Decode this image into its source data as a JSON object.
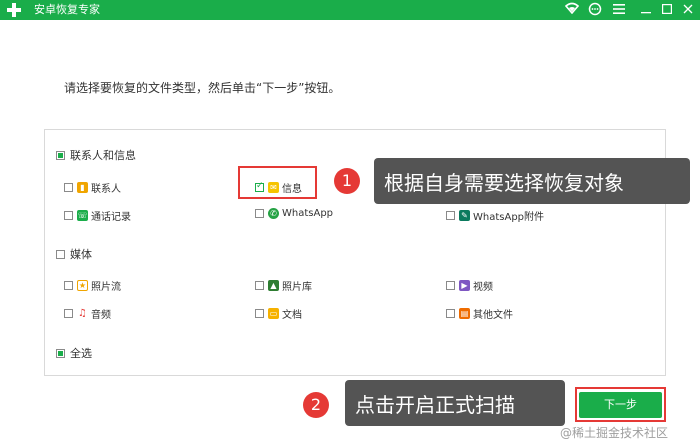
{
  "titlebar": {
    "title": "安卓恢复专家",
    "icons": [
      "wifi-icon",
      "chat-icon",
      "menu-icon",
      "minimize-icon",
      "maximize-icon",
      "close-icon"
    ],
    "color": "#1aad4a"
  },
  "instruction": "请选择要恢复的文件类型，然后单击“下一步”按钮。",
  "groups": {
    "contacts": {
      "label": "联系人和信息",
      "state": "partial",
      "items": {
        "contacts": {
          "label": "联系人",
          "checked": false,
          "icon": "contacts-icon",
          "color": "#f0a500"
        },
        "messages": {
          "label": "信息",
          "checked": true,
          "icon": "message-icon",
          "color": "#f6c400"
        },
        "calls": {
          "label": "通话记录",
          "checked": false,
          "icon": "phone-icon",
          "color": "#1aad4a"
        },
        "whatsapp": {
          "label": "WhatsApp",
          "checked": false,
          "icon": "whatsapp-icon",
          "color": "#25a244"
        },
        "whatsapp_att": {
          "label": "WhatsApp附件",
          "checked": false,
          "icon": "attachment-icon",
          "color": "#0b7a5e"
        }
      }
    },
    "media": {
      "label": "媒体",
      "state": "unchecked",
      "items": {
        "camera": {
          "label": "照片流",
          "checked": false,
          "icon": "star-icon",
          "color": "#f0a500"
        },
        "gallery": {
          "label": "照片库",
          "checked": false,
          "icon": "picture-icon",
          "color": "#2e7d32"
        },
        "video": {
          "label": "视频",
          "checked": false,
          "icon": "play-icon",
          "color": "#7e57c2"
        },
        "audio": {
          "label": "音频",
          "checked": false,
          "icon": "music-icon",
          "color": "#e53935"
        },
        "docs": {
          "label": "文档",
          "checked": false,
          "icon": "folder-icon",
          "color": "#f6b100"
        },
        "other": {
          "label": "其他文件",
          "checked": false,
          "icon": "file-icon",
          "color": "#ef6c00"
        }
      }
    },
    "all": {
      "label": "全选",
      "state": "partial"
    }
  },
  "callouts": {
    "one": {
      "num": "1",
      "text": "根据自身需要选择恢复对象"
    },
    "two": {
      "num": "2",
      "text": "点击开启正式扫描"
    }
  },
  "next_button": "下一步",
  "watermark": "@稀土掘金技术社区"
}
